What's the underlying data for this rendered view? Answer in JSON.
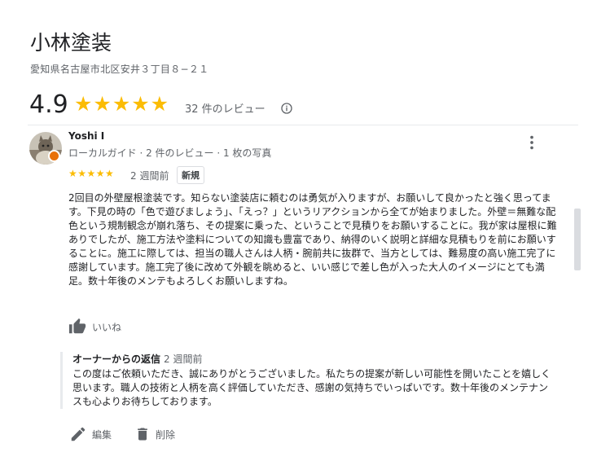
{
  "place": {
    "name": "小林塗装",
    "address": "愛知県名古屋市北区安井３丁目８−２１",
    "rating": "4.9",
    "stars": "★★★★★",
    "review_count": "32 件のレビュー"
  },
  "review": {
    "reviewer_name": "Yoshi I",
    "reviewer_meta": "ローカルガイド · 2 件のレビュー · 1 枚の写真",
    "stars": "★★★★★",
    "date": "2 週間前",
    "badge": "新規",
    "text": "2回目の外壁屋根塗装です。知らない塗装店に頼むのは勇気が入りますが、お願いして良かったと強く思ってます。下見の時の「色で遊びましょう」、「えっ？」というリアクションから全てが始まりました。外壁＝無難な配色という規制観念が崩れ落ち、その提案に乗った、ということで見積りをお願いすることに。我が家は屋根に難ありでしたが、施工方法や塗料についての知識も豊富であり、納得のいく説明と詳細な見積もりを前にお願いすることに。施工に際しては、担当の職人さんは人柄・腕前共に抜群で、当方としては、難易度の高い施工完了に感謝しています。施工完了後に改めて外観を眺めると、いい感じで差し色が入った大人のイメージにとても満足。数十年後のメンテもよろしくお願いしますね。",
    "like_label": "いいね"
  },
  "owner_reply": {
    "label": "オーナーからの返信",
    "date": "2 週間前",
    "text": "この度はご依頼いただき、誠にありがとうございました。私たちの提案が新しい可能性を開いたことを嬉しく思います。職人の技術と人柄を高く評価していただき、感謝の気持ちでいっぱいです。数十年後のメンテナンスも心よりお待ちしております。"
  },
  "actions": {
    "edit_label": "編集",
    "delete_label": "削除"
  },
  "colors": {
    "star": "#fbbc04",
    "badge": "#e8710a",
    "secondary_text": "#5f6368"
  },
  "icons": [
    "info-icon",
    "more-vert-icon",
    "thumb-up-icon",
    "pencil-icon",
    "trash-icon",
    "local-guide-badge-icon"
  ]
}
